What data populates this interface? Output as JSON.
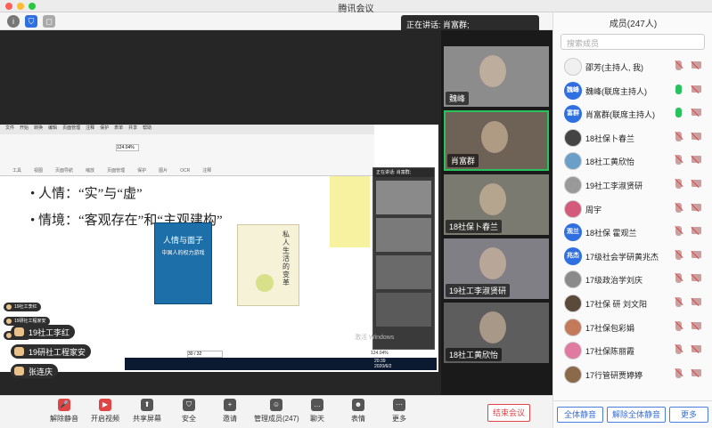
{
  "window": {
    "title": "腾讯会议"
  },
  "speaker": {
    "text": "正在讲话: 肖富群;"
  },
  "shared": {
    "ribbon_tabs": [
      "文件",
      "开始",
      "转换",
      "编辑",
      "页面管理",
      "注释",
      "保护",
      "表单",
      "共享",
      "帮助"
    ],
    "ribbon_groups": [
      "工具",
      "视图",
      "页面导航",
      "缩放",
      "页面管理",
      "保护",
      "图片",
      "OCR",
      "注释"
    ],
    "zoom": "124.04%",
    "bullet1": "• 人情：“实”与“虚”",
    "bullet2": "• 情境：“客观存在”和“主观建构”",
    "book1_title": "人情与面子",
    "book1_sub": "中国人的权力游戏",
    "book2_title": "私人生活的变革",
    "page_counter": "30 / 32",
    "mini_zoom": "124.04%",
    "time": "20:39",
    "date": "2020/6/2",
    "watermark": "激活 Windows",
    "mini_speaker": "正在讲话: 肖富群;"
  },
  "overlay_chips": [
    "19社工李红",
    "19研社工程家安",
    "张连庆"
  ],
  "chips": [
    "19社工李红",
    "19研社工程家安",
    "张连庆"
  ],
  "video_tiles": [
    {
      "label": "魏峰",
      "active": false
    },
    {
      "label": "肖富群",
      "active": true
    },
    {
      "label": "18社保卜春兰",
      "active": false
    },
    {
      "label": "19社工李淑贤研",
      "active": false
    },
    {
      "label": "18社工黄欣怡",
      "active": false
    }
  ],
  "panel": {
    "title": "成员(247人)",
    "search_placeholder": "搜索成员",
    "members": [
      {
        "name": "邵芳(主持人, 我)",
        "avatar_text": "",
        "color": "#f0f0f0",
        "mic_muted": true
      },
      {
        "name": "魏峰(联席主持人)",
        "avatar_text": "魏峰",
        "color": "#2f6fe0",
        "mic_muted": false
      },
      {
        "name": "肖富群(联席主持人)",
        "avatar_text": "富群",
        "color": "#2f6fe0",
        "mic_muted": false
      },
      {
        "name": "18社保卜春兰",
        "avatar_text": "",
        "color": "#444",
        "mic_muted": true
      },
      {
        "name": "18社工黄欣怡",
        "avatar_text": "",
        "color": "#6aa0c8",
        "mic_muted": true
      },
      {
        "name": "19社工李淑贤研",
        "avatar_text": "",
        "color": "#999",
        "mic_muted": true
      },
      {
        "name": "周宇",
        "avatar_text": "",
        "color": "#d35a7a",
        "mic_muted": true
      },
      {
        "name": "18社保 霍观兰",
        "avatar_text": "观兰",
        "color": "#2f6fe0",
        "mic_muted": true
      },
      {
        "name": "17级社会学研黄兆杰",
        "avatar_text": "兆杰",
        "color": "#2f6fe0",
        "mic_muted": true
      },
      {
        "name": "17级政治学刘庆",
        "avatar_text": "",
        "color": "#8a8a8a",
        "mic_muted": true
      },
      {
        "name": "17社保 研 刘文阳",
        "avatar_text": "",
        "color": "#5a4a3a",
        "mic_muted": true
      },
      {
        "name": "17社保包彩娟",
        "avatar_text": "",
        "color": "#c47a5a",
        "mic_muted": true
      },
      {
        "name": "17社保陈丽霞",
        "avatar_text": "",
        "color": "#e07aa0",
        "mic_muted": true
      },
      {
        "name": "17行管研贾婷婷",
        "avatar_text": "",
        "color": "#8a6a4a",
        "mic_muted": true
      }
    ],
    "mute_all": "全体静音",
    "unmute_all": "解除全体静音",
    "more": "更多"
  },
  "toolbar": [
    {
      "label": "解除静音",
      "icon": "mic-off-icon",
      "glyph": "🎤"
    },
    {
      "label": "开启视频",
      "icon": "video-off-icon",
      "glyph": "▶"
    },
    {
      "label": "共享屏幕",
      "icon": "share-screen-icon",
      "glyph": "⬆"
    },
    {
      "label": "安全",
      "icon": "shield-icon",
      "glyph": "⛉"
    },
    {
      "label": "邀请",
      "icon": "invite-icon",
      "glyph": "+"
    },
    {
      "label": "管理成员(247)",
      "icon": "members-icon",
      "glyph": "☺"
    },
    {
      "label": "聊天",
      "icon": "chat-icon",
      "glyph": "…"
    },
    {
      "label": "表情",
      "icon": "emoji-icon",
      "glyph": "☻"
    },
    {
      "label": "更多",
      "icon": "more-icon",
      "glyph": "⋯"
    }
  ],
  "end_meeting": "结束会议",
  "colors": {
    "accent": "#2f6fe0",
    "danger": "#e04545",
    "active_speaker": "#29c35e"
  }
}
